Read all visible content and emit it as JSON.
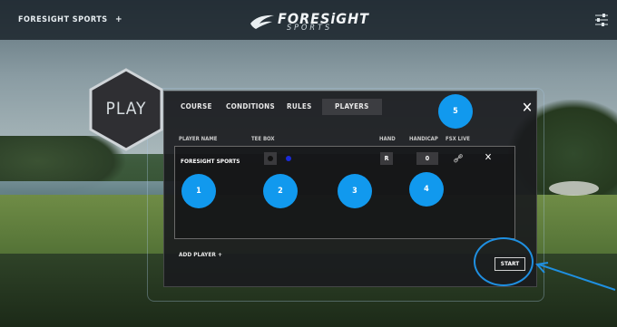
{
  "topbar": {
    "brand_left": "FORESIGHT SPORTS",
    "brand_plus": "+",
    "logo_name": "FORESiGHT",
    "logo_sub": "SPORTS"
  },
  "hex": {
    "label": "PLAY"
  },
  "tabs": [
    {
      "label": "COURSE",
      "active": false
    },
    {
      "label": "CONDITIONS",
      "active": false
    },
    {
      "label": "RULES",
      "active": false
    },
    {
      "label": "PLAYERS",
      "active": true
    }
  ],
  "columns": {
    "player_name": "PLAYER NAME",
    "tee_box": "TEE BOX",
    "hand": "HAND",
    "handicap": "HANDICAP",
    "fsx_live": "FSX LIVE"
  },
  "player": {
    "name": "FORESIGHT SPORTS",
    "hand": "R",
    "handicap": "0",
    "tee_colors": [
      "#111111",
      "#1a2bd8"
    ]
  },
  "markers": [
    "1",
    "2",
    "3",
    "4",
    "5"
  ],
  "add_player": "ADD PLAYER  +",
  "start": "START",
  "colors": {
    "accent": "#1199ee",
    "panel": "#1a1b1e"
  }
}
